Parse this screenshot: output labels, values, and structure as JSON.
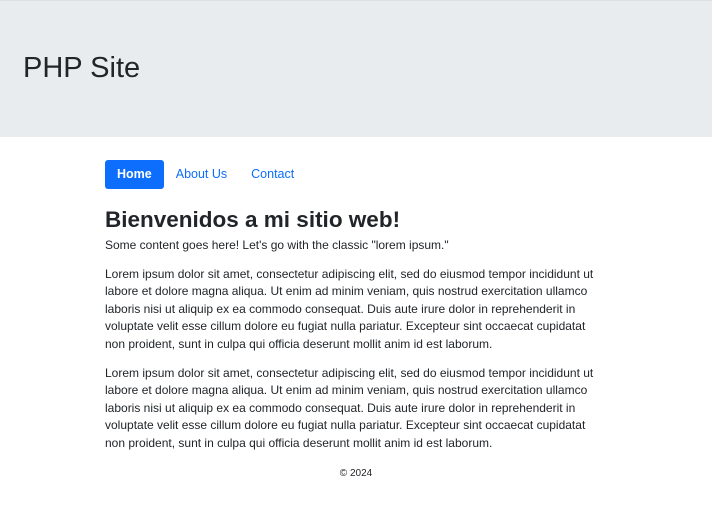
{
  "header": {
    "site_title": "PHP Site"
  },
  "nav": {
    "items": [
      {
        "label": "Home",
        "active": true
      },
      {
        "label": "About Us",
        "active": false
      },
      {
        "label": "Contact",
        "active": false
      }
    ]
  },
  "main": {
    "heading": "Bienvenidos a mi sitio web!",
    "intro": "Some content goes here! Let's go with the classic \"lorem ipsum.\"",
    "paragraphs": [
      "Lorem ipsum dolor sit amet, consectetur adipiscing elit, sed do eiusmod tempor incididunt ut labore et dolore magna aliqua. Ut enim ad minim veniam, quis nostrud exercitation ullamco laboris nisi ut aliquip ex ea commodo consequat. Duis aute irure dolor in reprehenderit in voluptate velit esse cillum dolore eu fugiat nulla pariatur. Excepteur sint occaecat cupidatat non proident, sunt in culpa qui officia deserunt mollit anim id est laborum.",
      "Lorem ipsum dolor sit amet, consectetur adipiscing elit, sed do eiusmod tempor incididunt ut labore et dolore magna aliqua. Ut enim ad minim veniam, quis nostrud exercitation ullamco laboris nisi ut aliquip ex ea commodo consequat. Duis aute irure dolor in reprehenderit in voluptate velit esse cillum dolore eu fugiat nulla pariatur. Excepteur sint occaecat cupidatat non proident, sunt in culpa qui officia deserunt mollit anim id est laborum."
    ]
  },
  "footer": {
    "text": "© 2024"
  },
  "colors": {
    "jumbotron_bg": "#e9ecef",
    "primary": "#0d6efd",
    "text": "#212529"
  }
}
